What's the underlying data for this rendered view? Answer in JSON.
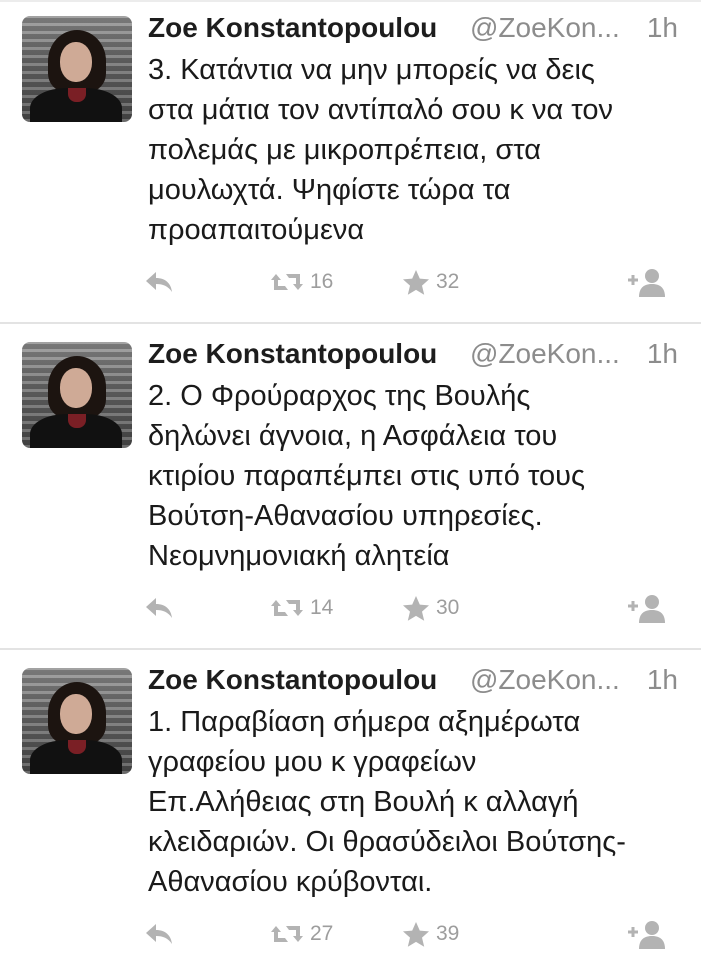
{
  "tweets": [
    {
      "name": "Zoe Konstantopoulou",
      "handle": "@ZoeKon...",
      "time": "1h",
      "lines": [
        "3. Κατάντια να μην μπορείς να δεις",
        "στα μάτια τον αντίπαλό σου κ να τον",
        "πολεμάς με μικροπρέπεια, στα",
        "μουλωχτά. Ψηφίστε τώρα τα",
        "προαπαιτούμενα"
      ],
      "retweets": "16",
      "favorites": "32"
    },
    {
      "name": "Zoe Konstantopoulou",
      "handle": "@ZoeKon...",
      "time": "1h",
      "lines": [
        "2. Ο Φρούραρχος της Βουλής",
        "δηλώνει άγνοια, η Ασφάλεια του",
        "κτιρίου παραπέμπει στις υπό τους",
        "Βούτση-Αθανασίου υπηρεσίες.",
        "Νεομνημονιακή αλητεία"
      ],
      "retweets": "14",
      "favorites": "30"
    },
    {
      "name": "Zoe Konstantopoulou",
      "handle": "@ZoeKon...",
      "time": "1h",
      "lines": [
        "1. Παραβίαση σήμερα αξημέρωτα",
        "γραφείου μου κ γραφείων",
        "Επ.Αλήθειας στη Βουλή κ αλλαγή",
        "κλειδαριών. Οι θρασύδειλοι Βούτσης-",
        "Αθανασίου κρύβονται."
      ],
      "retweets": "27",
      "favorites": "39"
    }
  ],
  "icons": {
    "reply": "reply-icon",
    "retweet": "retweet-icon",
    "favorite": "star-icon",
    "follow": "follow-user-icon"
  },
  "colors": {
    "text": "#1a1a1a",
    "muted": "#8c8c8c",
    "icon": "#b3b3b3",
    "divider": "#e3e3e3"
  }
}
